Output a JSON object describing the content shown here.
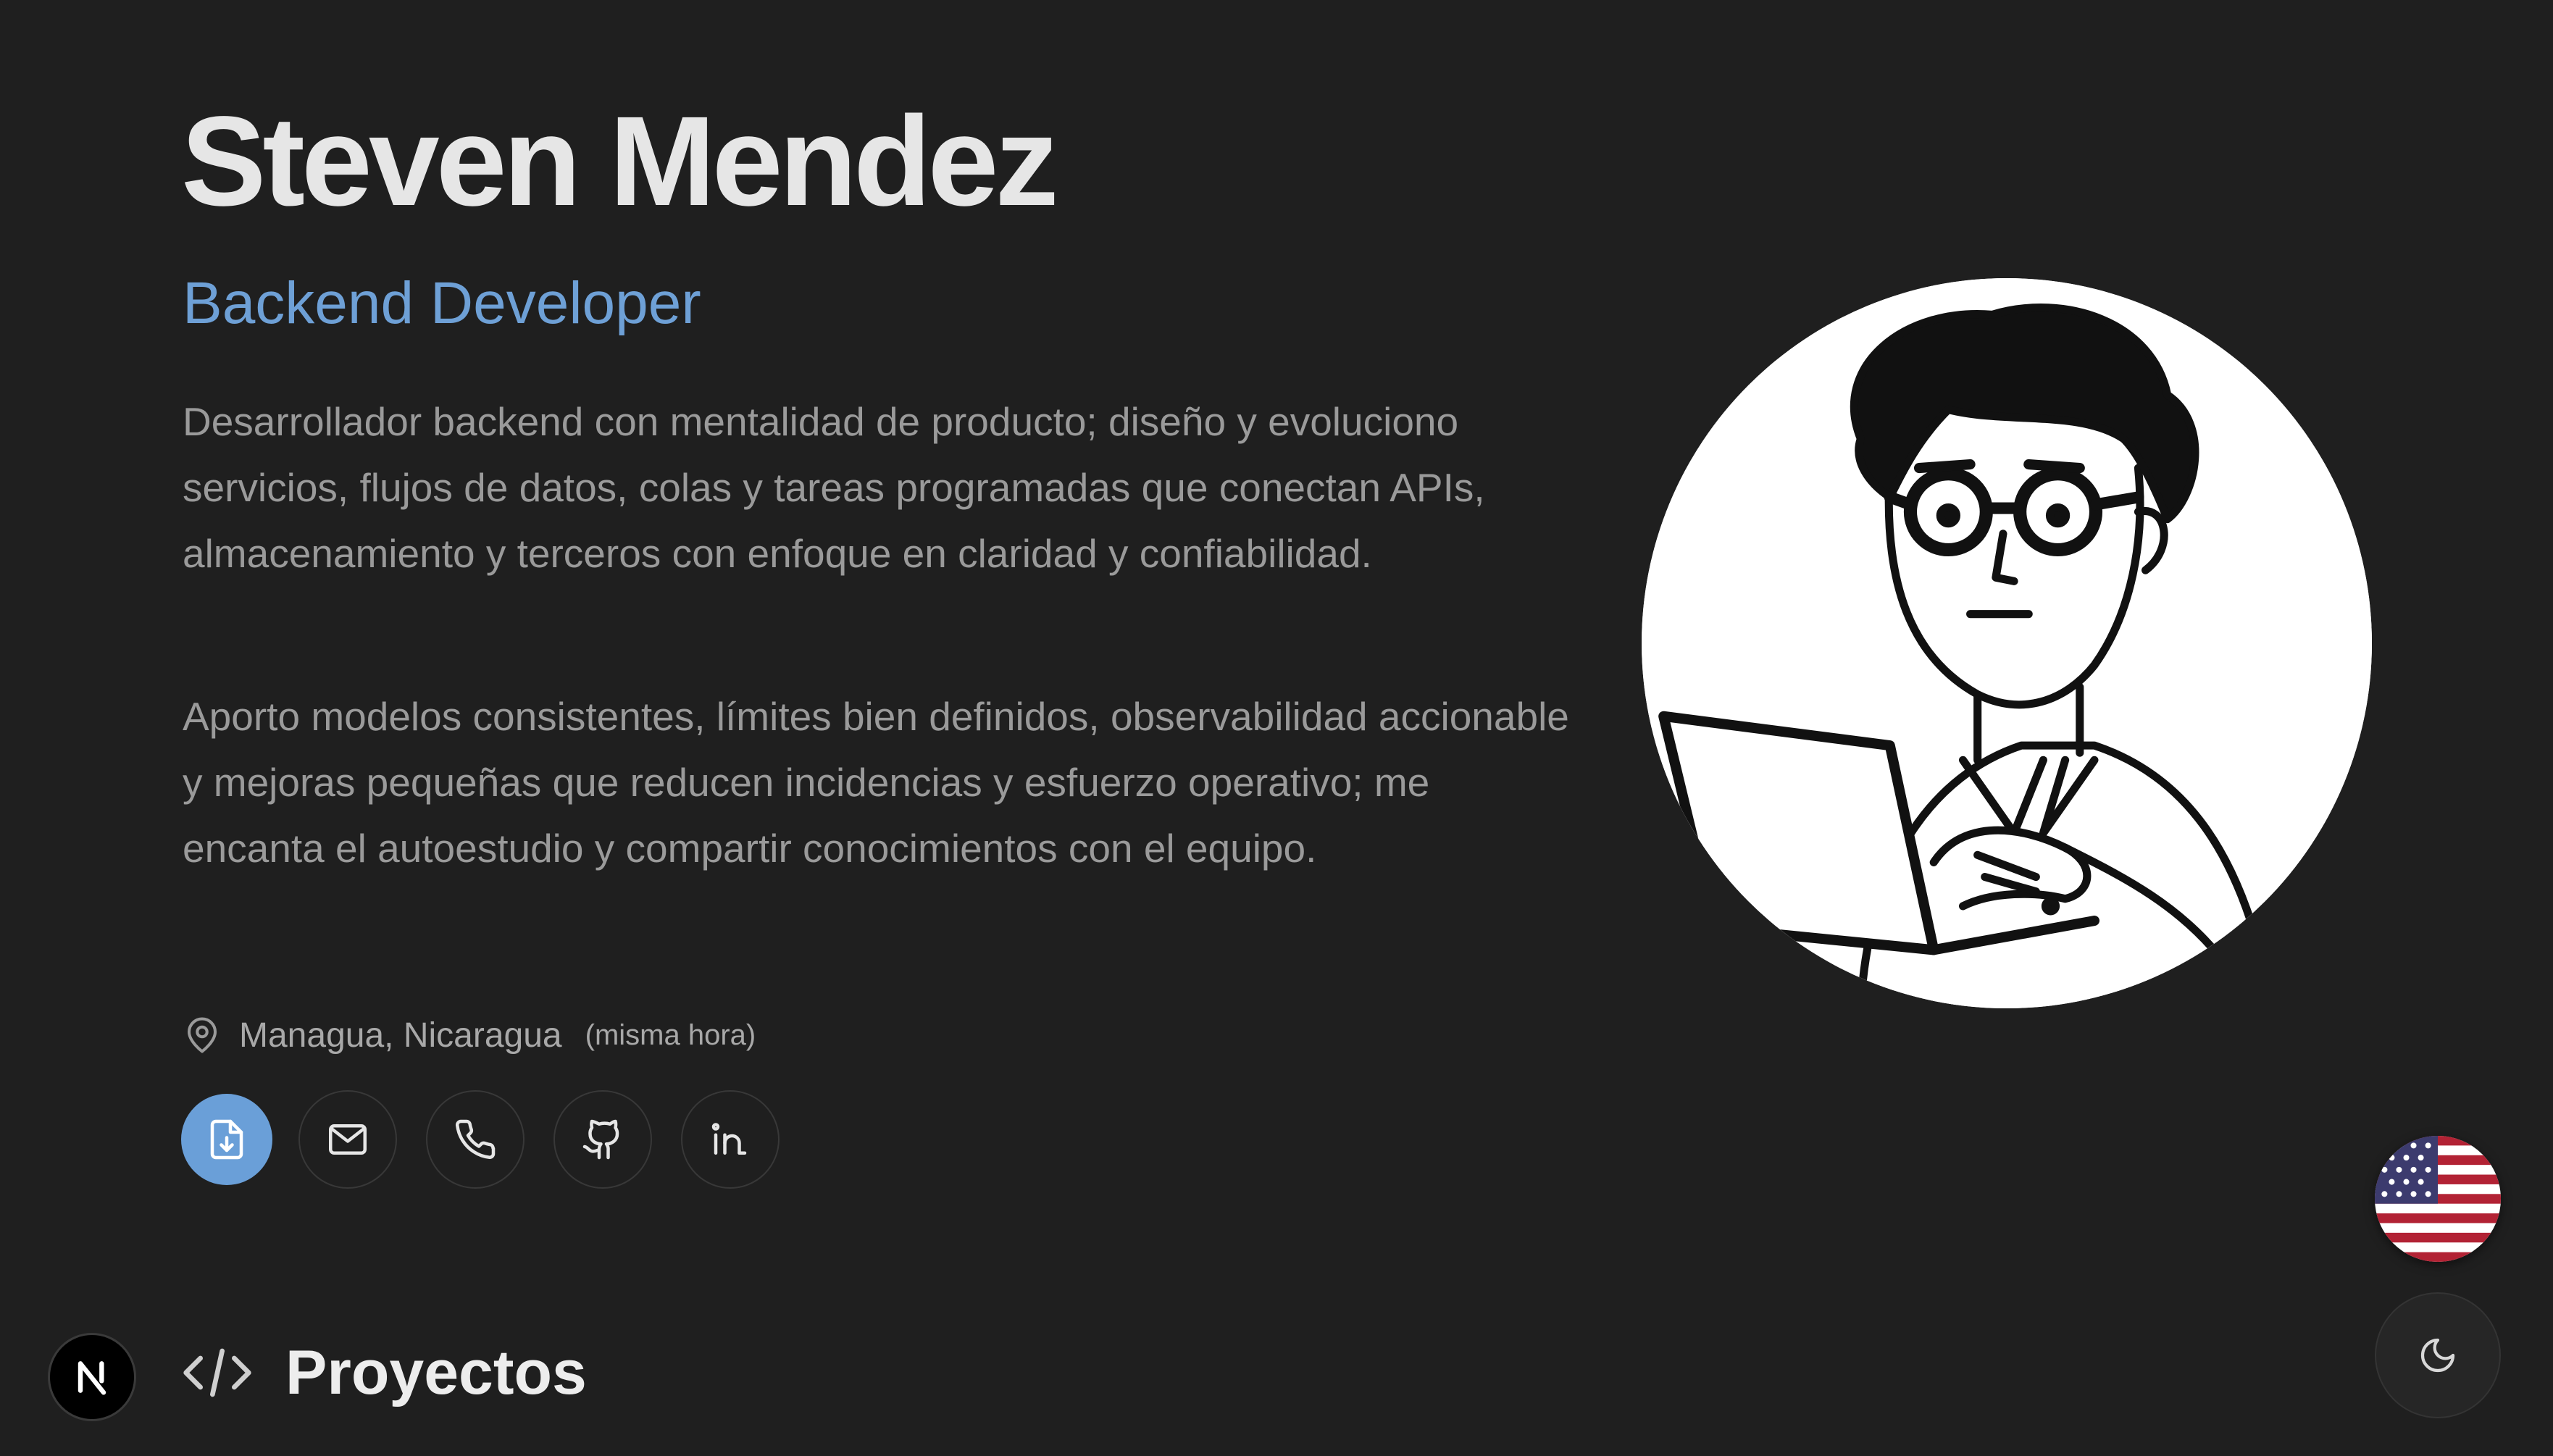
{
  "profile": {
    "name": "Steven Mendez",
    "role": "Backend Developer",
    "bio": [
      "Desarrollador backend con mentalidad de producto; diseño y evoluciono servicios, flujos de datos, colas y tareas programadas que conectan APIs, almacenamiento y terceros con enfoque en claridad y confiabilidad.",
      "Aporto modelos consistentes, límites bien definidos, observabilidad accionable y mejoras pequeñas que reducen incidencias y esfuerzo operativo; me encanta el autoestudio y compartir conocimientos con el equipo."
    ],
    "location": "Managua, Nicaragua",
    "timezone_note": "(misma hora)"
  },
  "actions": [
    {
      "name": "download-cv-button",
      "icon": "file-download-icon"
    },
    {
      "name": "email-button",
      "icon": "mail-icon"
    },
    {
      "name": "phone-button",
      "icon": "phone-icon"
    },
    {
      "name": "github-button",
      "icon": "github-icon"
    },
    {
      "name": "linkedin-button",
      "icon": "linkedin-icon"
    }
  ],
  "section": {
    "title": "Proyectos",
    "icon": "code-icon"
  },
  "controls": {
    "language_flag": "us-flag-icon",
    "theme_toggle": "moon-icon",
    "framework_badge": "nextjs-logo-icon"
  },
  "colors": {
    "background": "#1f1f1f",
    "accent": "#6a9fd8",
    "heading": "#e6e6e6",
    "body_text": "#9a9a9a"
  }
}
